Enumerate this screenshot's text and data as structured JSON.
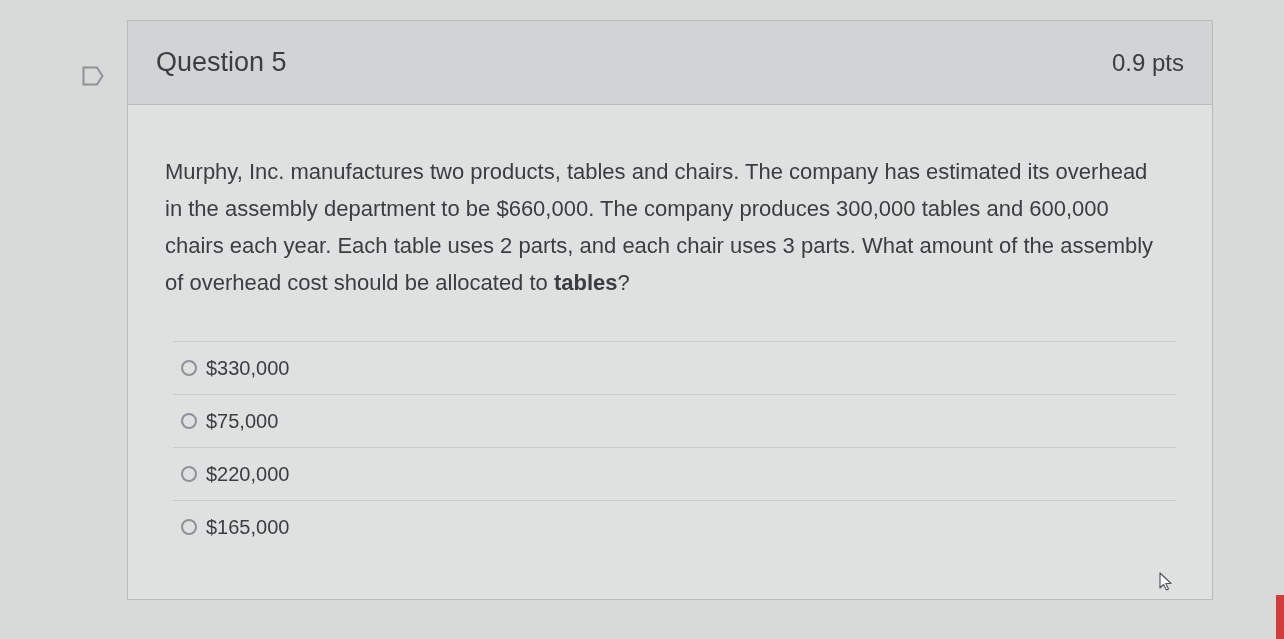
{
  "question": {
    "title": "Question 5",
    "points": "0.9 pts"
  },
  "prompt": "Murphy, Inc. manufactures two products, tables and chairs. The company has estimated its overhead in the assembly department to be $660,000. The company produces 300,000 tables and 600,000 chairs each year. Each table uses 2 parts, and each chair uses 3 parts. What amount of the assembly of overhead cost should be allocated to **tables**?",
  "answers": [
    {
      "label": "$330,000",
      "selected": false
    },
    {
      "label": "$75,000",
      "selected": false
    },
    {
      "label": "$220,000",
      "selected": false
    },
    {
      "label": "$165,000",
      "selected": false
    }
  ]
}
